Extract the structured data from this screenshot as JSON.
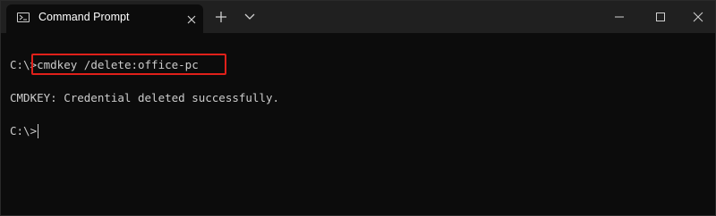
{
  "tab": {
    "title": "Command Prompt",
    "icon": "command-prompt-icon"
  },
  "titlebar": {
    "new_tab_icon": "plus-icon",
    "dropdown_icon": "chevron-down-icon",
    "minimize_icon": "minimize-icon",
    "maximize_icon": "maximize-icon",
    "close_icon": "close-icon"
  },
  "terminal": {
    "lines": [
      {
        "prompt": "C:\\>",
        "command": "cmdkey /delete:office-pc"
      },
      {
        "output": "CMDKEY: Credential deleted successfully."
      },
      {
        "prompt": "C:\\>",
        "command": ""
      }
    ]
  },
  "colors": {
    "titlebar_bg": "#202020",
    "terminal_bg": "#0c0c0c",
    "text": "#cccccc",
    "highlight": "#e0201a"
  }
}
